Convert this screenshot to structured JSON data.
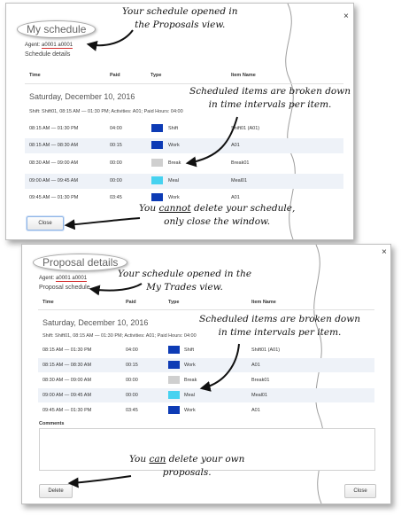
{
  "colors": {
    "shift": "#0d3bb5",
    "work": "#0d3bb5",
    "break": "#cfcfcf",
    "meal": "#46d2f0",
    "agent_underline": "#d32f2f"
  },
  "schedule_dialog": {
    "title": "My schedule",
    "agent_label": "Agent:",
    "agent_value": "a0001 a0001",
    "section": "Schedule details",
    "close_icon": "×",
    "columns": [
      "Time",
      "Paid",
      "Type",
      "Item Name"
    ],
    "date": "Saturday, December 10, 2016",
    "shift_info": "Shift: Shift01, 08:15 AM — 01:30 PM; Activities: A01; Paid Hours: 04:00",
    "rows": [
      {
        "time": "08:15 AM — 01:30 PM",
        "paid": "04:00",
        "type": "Shift",
        "item": "Shift01 (A01)"
      },
      {
        "time": "08:15 AM — 08:30 AM",
        "paid": "00:15",
        "type": "Work",
        "item": "A01"
      },
      {
        "time": "08:30 AM — 09:00 AM",
        "paid": "00:00",
        "type": "Break",
        "item": "Break01"
      },
      {
        "time": "09:00 AM — 09:45 AM",
        "paid": "00:00",
        "type": "Meal",
        "item": "Meal01"
      },
      {
        "time": "09:45 AM — 01:30 PM",
        "paid": "03:45",
        "type": "Work",
        "item": "A01"
      }
    ],
    "close_button": "Close"
  },
  "proposal_dialog": {
    "title": "Proposal details",
    "agent_label": "Agent:",
    "agent_value": "a0001 a0001",
    "section": "Proposal schedule",
    "close_icon": "×",
    "columns": [
      "Time",
      "Paid",
      "Type",
      "Item Name"
    ],
    "date": "Saturday, December 10, 2016",
    "shift_info": "Shift: Shift01, 08:15 AM — 01:30 PM; Activities: A01; Paid Hours: 04:00",
    "rows": [
      {
        "time": "08:15 AM — 01:30 PM",
        "paid": "04:00",
        "type": "Shift",
        "item": "Shift01 (A01)"
      },
      {
        "time": "08:15 AM — 08:30 AM",
        "paid": "00:15",
        "type": "Work",
        "item": "A01"
      },
      {
        "time": "08:30 AM — 09:00 AM",
        "paid": "00:00",
        "type": "Break",
        "item": "Break01"
      },
      {
        "time": "09:00 AM — 09:45 AM",
        "paid": "00:00",
        "type": "Meal",
        "item": "Meal01"
      },
      {
        "time": "09:45 AM — 01:30 PM",
        "paid": "03:45",
        "type": "Work",
        "item": "A01"
      }
    ],
    "comments_label": "Comments",
    "delete_button": "Delete",
    "close_button": "Close"
  },
  "annotations": {
    "a1_line1": "Your schedule opened in",
    "a1_line2": "the Proposals view.",
    "a2_line1": "Scheduled items are broken down",
    "a2_line2": "in time intervals per item.",
    "a3_pre": "You ",
    "a3_em": "cannot",
    "a3_post": " delete your schedule,",
    "a3_line2": "only close the window.",
    "a4_line1": "Your schedule opened in the",
    "a4_line2": "My Trades view.",
    "a5_line1": "Scheduled items are broken down",
    "a5_line2": "in time intervals per item.",
    "a6_pre": "You ",
    "a6_em": "can",
    "a6_post": " delete your own",
    "a6_line2": "proposals."
  }
}
